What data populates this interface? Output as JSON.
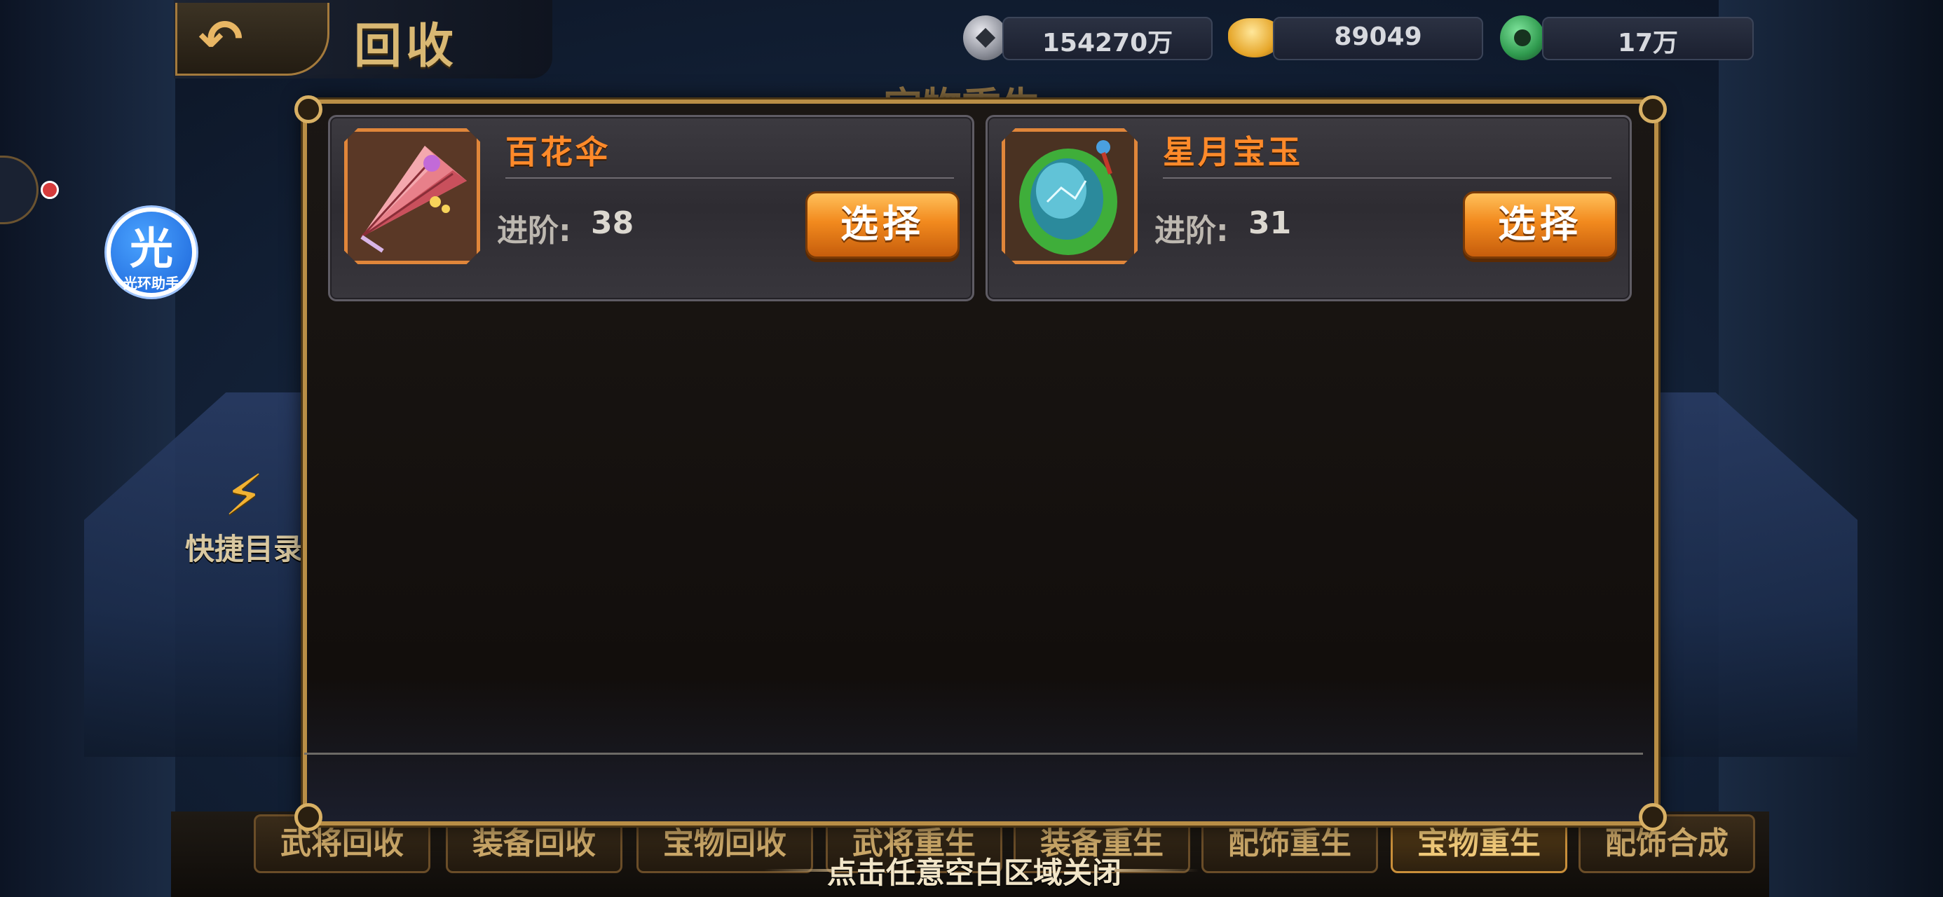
{
  "header": {
    "title": "回收",
    "back_label": "back"
  },
  "resources": {
    "silver": "154270万",
    "gold": "89049",
    "jade": "17万"
  },
  "assistant": {
    "glyph": "光",
    "caption": "光环助手"
  },
  "quick_menu": {
    "label": "快捷目录"
  },
  "background_title": "宝物重生",
  "items": [
    {
      "name": "百花伞",
      "advance_label": "进阶:",
      "advance_value": "38",
      "button_label": "选择",
      "icon": "umbrella-icon"
    },
    {
      "name": "星月宝玉",
      "advance_label": "进阶:",
      "advance_value": "31",
      "button_label": "选择",
      "icon": "jade-orb-icon"
    }
  ],
  "tabs": [
    {
      "label": "武将回收",
      "active": false
    },
    {
      "label": "装备回收",
      "active": false
    },
    {
      "label": "宝物回收",
      "active": false
    },
    {
      "label": "武将重生",
      "active": false
    },
    {
      "label": "装备重生",
      "active": false
    },
    {
      "label": "配饰重生",
      "active": false
    },
    {
      "label": "宝物重生",
      "active": true
    },
    {
      "label": "配饰合成",
      "active": false
    }
  ],
  "close_hint": "点击任意空白区域关闭",
  "colors": {
    "accent_orange": "#f28a1e",
    "item_title": "#ff8a2a",
    "frame_gold": "#b98e46"
  }
}
